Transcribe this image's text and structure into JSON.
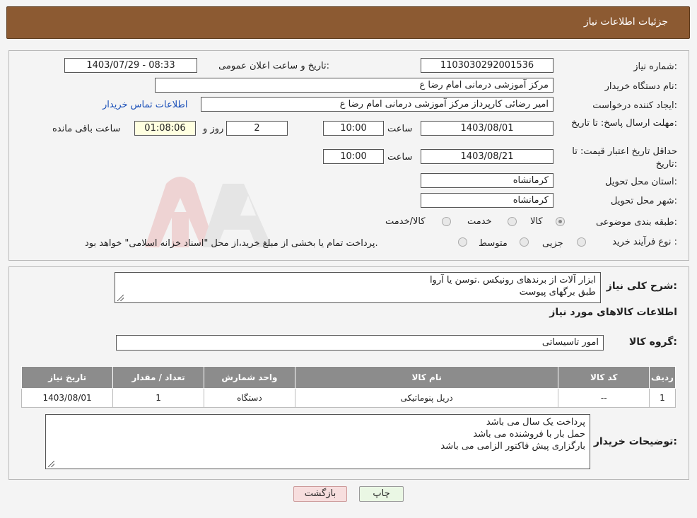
{
  "header": {
    "title": "جزئیات اطلاعات نیاز"
  },
  "details": {
    "need_number_label": "شماره نیاز:",
    "need_number": "1103030292001536",
    "announce_label": "تاریخ و ساعت اعلان عمومی:",
    "announce_value": "1403/07/29 - 08:33",
    "buyer_org_label": "نام دستگاه خریدار:",
    "buyer_org": "مرکز آموزشی  درمانی امام رضا  ع",
    "creator_label": "ایجاد کننده درخواست:",
    "creator": "امیر رضائی کارپرداز مرکز آموزشی  درمانی امام رضا  ع",
    "contact_link": "اطلاعات تماس خریدار",
    "reply_deadline_label": "مهلت ارسال پاسخ: تا تاریخ:",
    "reply_date": "1403/08/01",
    "time_label": "ساعت",
    "reply_time": "10:00",
    "days_value": "2",
    "days_label": "روز و",
    "remaining_value": "01:08:06",
    "remaining_label": "ساعت باقی مانده",
    "price_validity_label": "حداقل تاریخ اعتبار قیمت: تا تاریخ:",
    "price_date": "1403/08/21",
    "price_time": "10:00",
    "province_label": "استان محل تحویل:",
    "province": "کرمانشاه",
    "city_label": "شهر محل تحویل:",
    "city": "کرمانشاه",
    "category_label": "طبقه بندی موضوعی:",
    "category_options": [
      "کالا",
      "خدمت",
      "کالا/خدمت"
    ],
    "process_label": "نوع فرآیند خرید :",
    "process_options": [
      "جزیی",
      "متوسط"
    ],
    "process_note": "پرداخت تمام یا بخشی از مبلغ خرید،از محل \"اسناد خزانه اسلامی\" خواهد بود."
  },
  "need": {
    "summary_label": "شرح کلی نیاز:",
    "summary_lines": [
      "ابزار آلات از برندهای رونیکس .توسن یا آروا",
      "طبق برگهای پیوست"
    ],
    "items_title": "اطلاعات کالاهای مورد نیاز",
    "group_label": "گروه کالا:",
    "group_value": "امور تاسیساتی",
    "table": {
      "headers": [
        "ردیف",
        "کد کالا",
        "نام کالا",
        "واحد شمارش",
        "تعداد / مقدار",
        "تاریخ نیاز"
      ],
      "rows": [
        [
          "1",
          "--",
          "دریل پنوماتیکی",
          "دستگاه",
          "1",
          "1403/08/01"
        ]
      ]
    },
    "buyer_notes_label": "توضیحات خریدار:",
    "buyer_notes_lines": [
      "پرداخت یک سال می باشد",
      "حمل بار با فروشنده می باشد",
      "بارگزاری پیش فاکتور الزامی می باشد"
    ]
  },
  "buttons": {
    "print": "چاپ",
    "back": "بازگشت"
  },
  "colors": {
    "header": "#8c5a32",
    "table_header": "#8c8c8c",
    "back_button": "#f7dede",
    "print_button": "#eaf7e4",
    "link": "#1a4fb8"
  }
}
